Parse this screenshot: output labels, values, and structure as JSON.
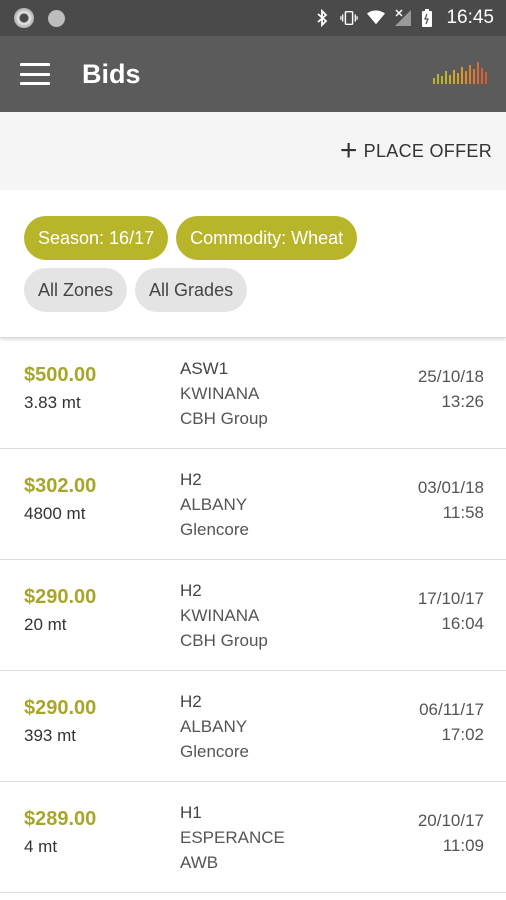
{
  "status": {
    "time": "16:45",
    "icons": [
      "chrome-icon",
      "circle-icon",
      "bluetooth-icon",
      "vibrate-icon",
      "wifi-icon",
      "signal-icon",
      "battery-icon"
    ]
  },
  "appbar": {
    "title": "Bids",
    "bg_color": "#5b5b5b"
  },
  "actions": {
    "place_offer": "PLACE OFFER"
  },
  "filters": {
    "season": "Season: 16/17",
    "commodity": "Commodity: Wheat",
    "zones": "All Zones",
    "grades": "All Grades",
    "accent_color": "#b8b52b"
  },
  "bids": [
    {
      "price": "$500.00",
      "qty": "3.83 mt",
      "grade": "ASW1",
      "port": "KWINANA",
      "buyer": "CBH Group",
      "date": "25/10/18",
      "time": "13:26"
    },
    {
      "price": "$302.00",
      "qty": "4800 mt",
      "grade": "H2",
      "port": "ALBANY",
      "buyer": "Glencore",
      "date": "03/01/18",
      "time": "11:58"
    },
    {
      "price": "$290.00",
      "qty": "20 mt",
      "grade": "H2",
      "port": "KWINANA",
      "buyer": "CBH Group",
      "date": "17/10/17",
      "time": "16:04"
    },
    {
      "price": "$290.00",
      "qty": "393 mt",
      "grade": "H2",
      "port": "ALBANY",
      "buyer": "Glencore",
      "date": "06/11/17",
      "time": "17:02"
    },
    {
      "price": "$289.00",
      "qty": "4 mt",
      "grade": "H1",
      "port": "ESPERANCE",
      "buyer": "AWB",
      "date": "20/10/17",
      "time": "11:09"
    }
  ]
}
